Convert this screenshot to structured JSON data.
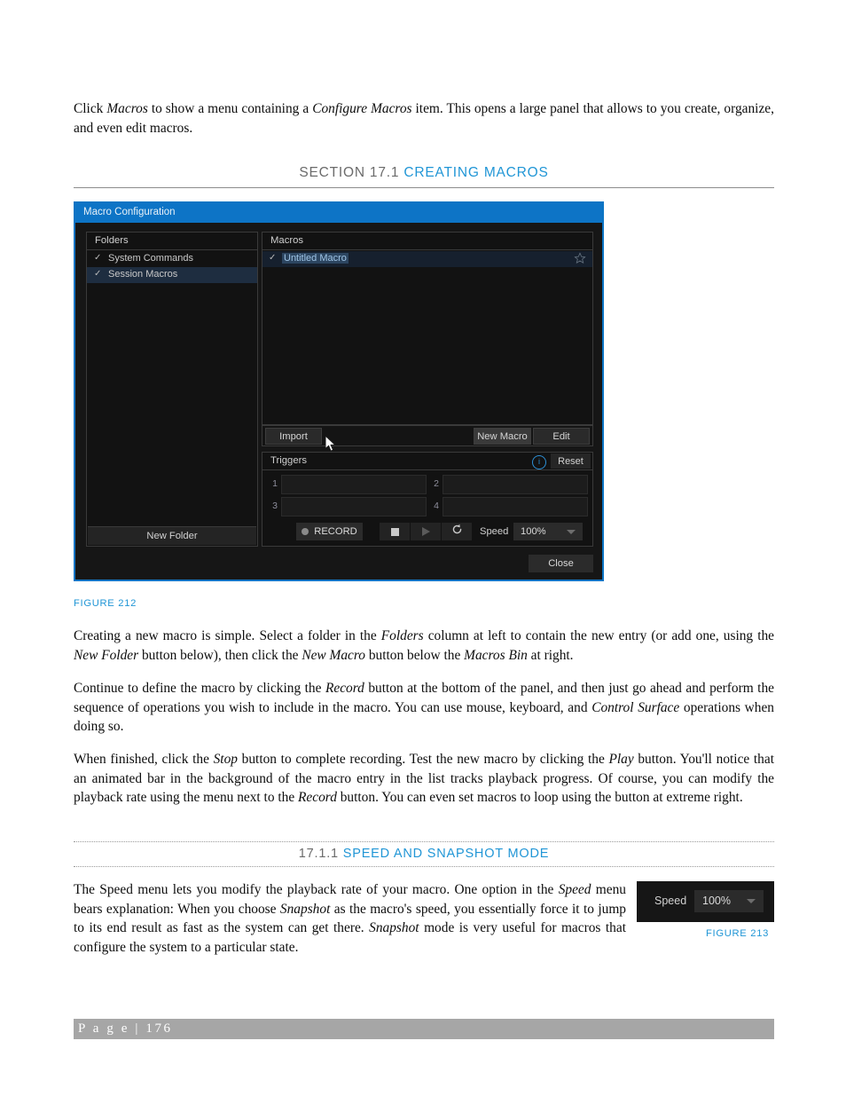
{
  "document": {
    "intro_paragraph": {
      "prefix": "Click ",
      "em1": "Macros",
      "mid1": " to show a menu containing a ",
      "em2": "Configure Macros",
      "suffix": " item. This opens a large panel that allows to you create, organize, and even edit macros."
    },
    "section": {
      "number": "SECTION 17.1",
      "title": "CREATING MACROS"
    },
    "subsection": {
      "number": "17.1.1",
      "title": "SPEED AND SNAPSHOT MODE"
    },
    "para_creating": {
      "t1": "Creating a new macro is simple.  Select a folder in the ",
      "em1": "Folders",
      "t2": " column at left to contain the new entry (or add one, using the ",
      "em2": "New Folder",
      "t3": " button below), then click the ",
      "em3": "New Macro",
      "t4": " button below the ",
      "em4": "Macros Bin",
      "t5": " at right."
    },
    "para_continue": {
      "t1": "Continue to define the macro by clicking the ",
      "em1": "Record",
      "t2": " button at the bottom of the panel, and then just go ahead and perform the sequence of operations you wish to include in the macro.  You can use mouse, keyboard, and ",
      "em2": "Control Surface",
      "t3": " operations when doing so."
    },
    "para_finished": {
      "t1": "When finished, click the ",
      "em1": "Stop",
      "t2": " button to complete recording. Test the new macro by clicking the ",
      "em2": "Play",
      "t3": " button. You'll notice that an animated bar in the background of the macro entry in the list tracks playback progress. Of course, you can modify the playback rate using the menu next to the ",
      "em3": "Record",
      "t4": " button.  You can even set macros to loop using the button at extreme right."
    },
    "para_speed": {
      "t1": "The Speed menu lets you modify the playback rate of your macro.  One option in the ",
      "em1": "Speed",
      "t2": " menu bears explanation:  When you choose ",
      "em2": "Snapshot",
      "t3": " as the macro's speed, you essentially force it to jump to its end result as fast as the system can get there. ",
      "em3": "Snapshot",
      "t4": " mode is very useful for macros that configure the system to a particular state."
    },
    "figure_212_caption": "FIGURE 212",
    "figure_213_caption": "FIGURE 213",
    "footer": "P a g e  |  176"
  },
  "figure_212": {
    "titlebar": "Macro Configuration",
    "folders_panel": {
      "header": "Folders",
      "items": [
        {
          "label": "System Commands",
          "checked": "✓",
          "selected": false
        },
        {
          "label": "Session Macros",
          "checked": "✓",
          "selected": true
        }
      ],
      "new_folder_button": "New Folder"
    },
    "macros_panel": {
      "header": "Macros",
      "items": [
        {
          "label": "Untitled Macro",
          "checked": "✓",
          "starred": false
        }
      ]
    },
    "actions": {
      "import": "Import",
      "new_macro": "New Macro",
      "edit": "Edit"
    },
    "triggers_panel": {
      "header": "Triggers",
      "info_glyph": "i",
      "reset": "Reset",
      "slots": [
        {
          "number": "1",
          "value": ""
        },
        {
          "number": "2",
          "value": ""
        },
        {
          "number": "3",
          "value": ""
        },
        {
          "number": "4",
          "value": ""
        }
      ]
    },
    "transport": {
      "record": "RECORD",
      "speed_label": "Speed",
      "speed_value": "100%"
    },
    "close_button": "Close"
  },
  "figure_213": {
    "speed_label": "Speed",
    "speed_value": "100%"
  },
  "colors": {
    "accent_blue": "#2196d6",
    "titlebar_blue": "#0d74c6",
    "footer_gray": "#a6a6a6"
  }
}
